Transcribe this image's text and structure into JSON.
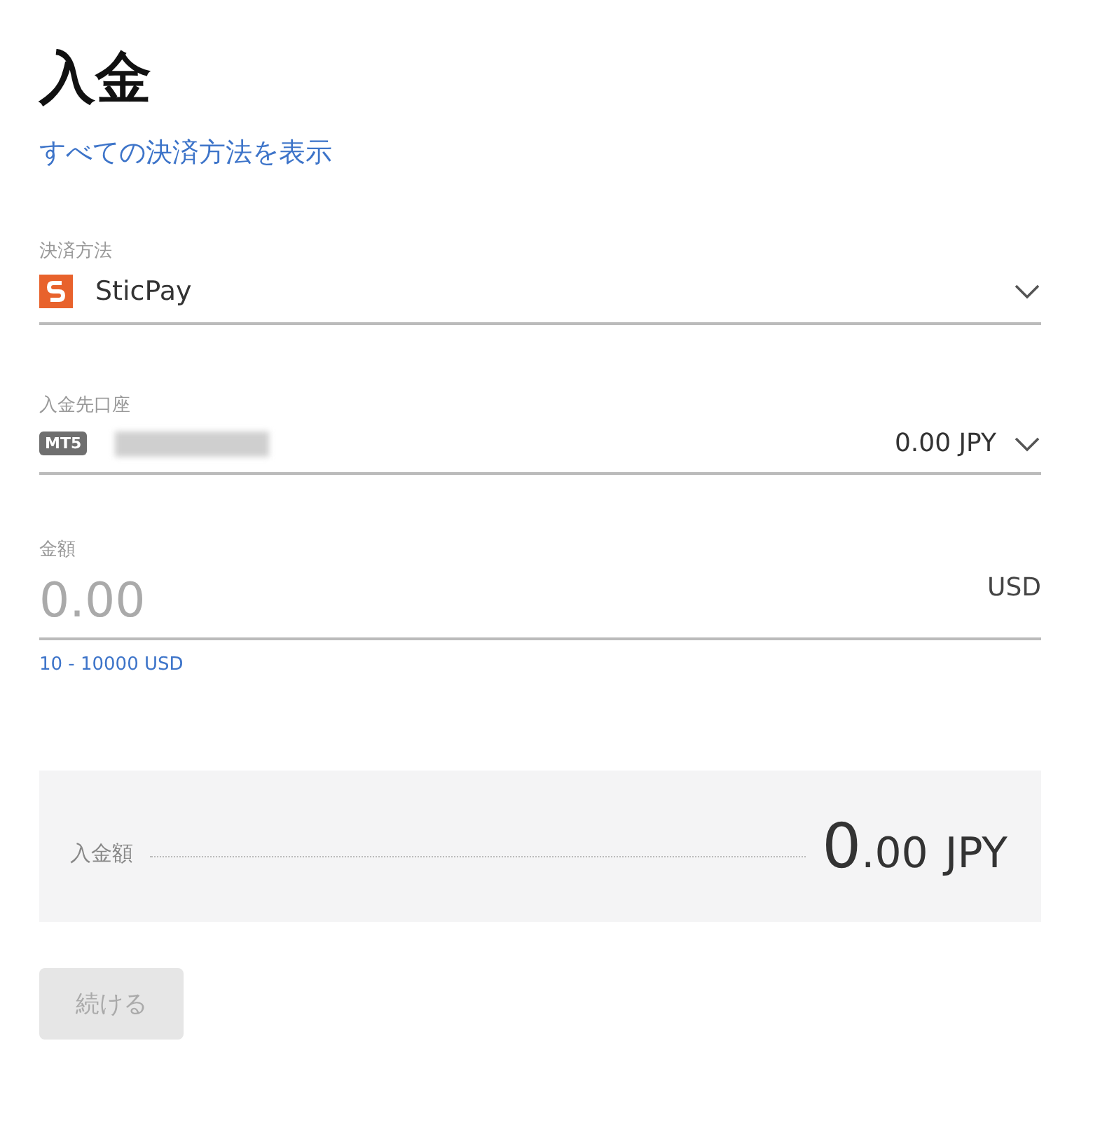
{
  "title": "入金",
  "all_methods_link": "すべての決済方法を表示",
  "payment_method": {
    "label": "決済方法",
    "value": "SticPay"
  },
  "account": {
    "label": "入金先口座",
    "badge": "MT5",
    "balance": "0.00 JPY"
  },
  "amount": {
    "label": "金額",
    "placeholder": "0.00",
    "currency": "USD",
    "range": "10 - 10000 USD"
  },
  "summary": {
    "label": "入金額",
    "integer": "0",
    "fraction": ".00",
    "currency": "JPY"
  },
  "continue_button": {
    "label": "続ける",
    "disabled": true
  }
}
